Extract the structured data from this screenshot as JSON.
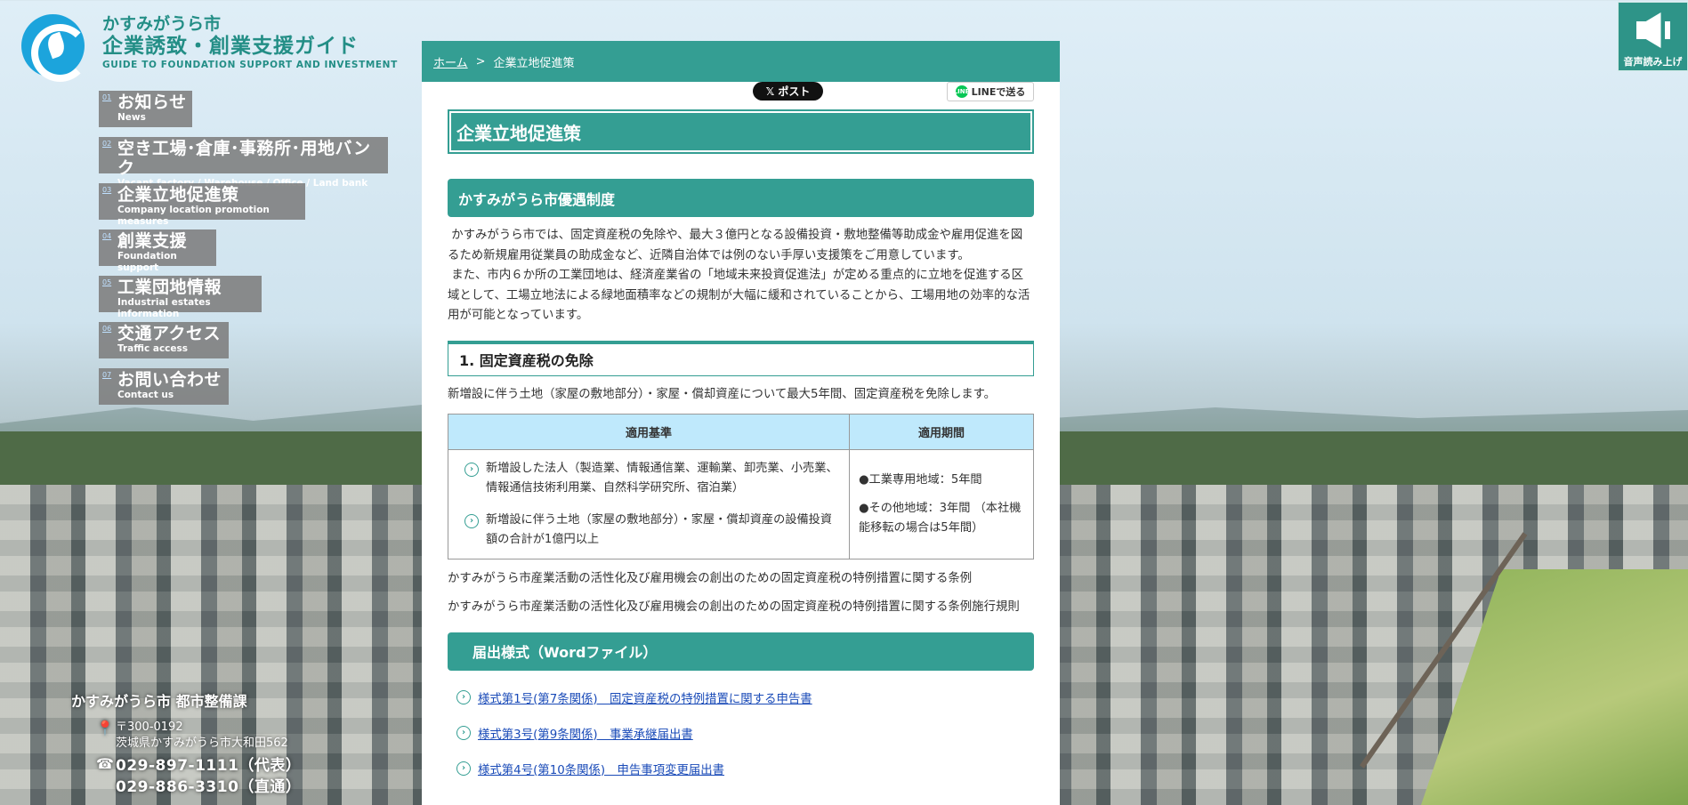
{
  "brand": {
    "city": "かすみがうら市",
    "title": "企業誘致・創業支援ガイド",
    "subtitle": "GUIDE TO FOUNDATION SUPPORT AND INVESTMENT"
  },
  "nav": [
    {
      "num": "01",
      "jp": "お知らせ",
      "en": "News"
    },
    {
      "num": "02",
      "jp": "空き工場･倉庫･事務所･用地バンク",
      "en": "Vacant factory / Warehouse / Office / Land bank"
    },
    {
      "num": "03",
      "jp": "企業立地促進策",
      "en": "Company location promotion measures"
    },
    {
      "num": "04",
      "jp": "創業支援",
      "en": "Foundation support"
    },
    {
      "num": "05",
      "jp": "工業団地情報",
      "en": "Industrial estates information"
    },
    {
      "num": "06",
      "jp": "交通アクセス",
      "en": "Traffic access"
    },
    {
      "num": "07",
      "jp": "お問い合わせ",
      "en": "Contact us"
    }
  ],
  "contact": {
    "dept": "かすみがうら市 都市整備課",
    "postal": "〒300-0192",
    "address": "茨城県かすみがうら市大和田562",
    "tel_main": "029-897-1111（代表）",
    "tel_direct": "029-886-3310（直通）"
  },
  "voice": {
    "label": "音声読み上げ"
  },
  "breadcrumb": {
    "home": "ホーム",
    "sep": ">",
    "current": "企業立地促進策"
  },
  "share": {
    "x_label": "𝕏 ポスト",
    "line_label": "LINEで送る",
    "line_mark": "LINE"
  },
  "page": {
    "title": "企業立地促進策",
    "section1": "かすみがうら市優遇制度",
    "intro1": " かすみがうら市では、固定資産税の免除や、最大３億円となる設備投資・敷地整備等助成金や雇用促進を図るため新規雇用従業員の助成金など、近隣自治体では例のない手厚い支援策をご用意しています。",
    "intro2": " また、市内６か所の工業団地は、経済産業省の「地域未来投資促進法」が定める重点的に立地を促進する区域として、工場立地法による緑地面積率などの規制が大幅に緩和されていることから、工場用地の効率的な活用が可能となっています。",
    "sub1": "1. 固定資産税の免除",
    "sub1_note": "新増設に伴う土地（家屋の敷地部分）・家屋・償却資産について最大5年間、固定資産税を免除します。",
    "table": {
      "headers": [
        "適用基準",
        "適用期間"
      ],
      "criteria": [
        "新増設した法人（製造業、情報通信業、運輸業、卸売業、小売業、情報通信技術利用業、自然科学研究所、宿泊業）",
        "新増設に伴う土地（家屋の敷地部分）・家屋・償却資産の設備投資額の合計が1億円以上"
      ],
      "periods": [
        "●工業専用地域：5年間",
        "●その他地域：3年間 （本社機能移転の場合は5年間）"
      ]
    },
    "ordinance1": "かすみがうら市産業活動の活性化及び雇用機会の創出のための固定資産税の特例措置に関する条例",
    "ordinance2": "かすみがうら市産業活動の活性化及び雇用機会の創出のための固定資産税の特例措置に関する条例施行規則",
    "section2": "届出様式（Wordファイル）",
    "forms": [
      "様式第1号(第7条関係)　固定資産税の特例措置に関する申告書",
      "様式第3号(第9条関係)　事業承継届出書",
      "様式第4号(第10条関係)　申告事項変更届出書"
    ]
  }
}
